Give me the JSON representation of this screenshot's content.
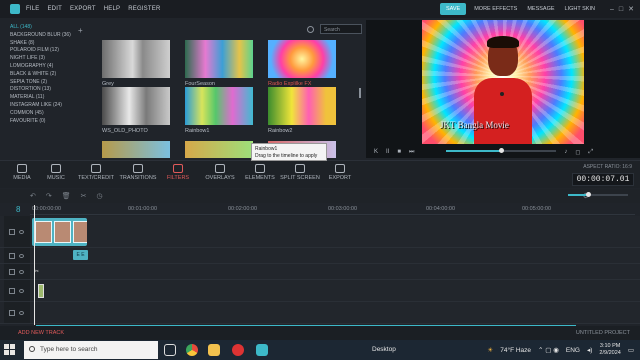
{
  "menu": {
    "items": [
      "FILE",
      "EDIT",
      "EXPORT",
      "HELP",
      "REGISTER"
    ],
    "save": "SAVE",
    "more_effects": "MORE EFFECTS",
    "message": "MESSAGE",
    "skin": "LIGHT SKIN"
  },
  "categories": [
    "ALL (148)",
    "BACKGROUND BLUR (36)",
    "SHAKE (8)",
    "POLAROID FILM (12)",
    "NIGHT LIFE (3)",
    "LOMOGRAPHY (4)",
    "BLACK & WHITE (2)",
    "SEPIA TONE (2)",
    "DISTORTION (13)",
    "MATERIAL (11)",
    "INSTAGRAM LIKE (24)",
    "COMMON (45)",
    "FAVOURITE (0)"
  ],
  "search": {
    "placeholder": "Search"
  },
  "effects": [
    {
      "label": "Grey",
      "highlight": false
    },
    {
      "label": "FourSeason",
      "highlight": false
    },
    {
      "label": "Radio Explilke FX",
      "highlight": true
    },
    {
      "label": "WS_OLD_PHOTO",
      "highlight": false
    },
    {
      "label": "Rainbow1",
      "highlight": false
    },
    {
      "label": "Rainbow2",
      "highlight": false
    }
  ],
  "tooltip": {
    "title": "Rainbow1",
    "hint": "Drag to the timeline to apply"
  },
  "preview": {
    "overlay_text": "JKT Bangla Movie"
  },
  "tools": [
    {
      "label": "MEDIA",
      "active": false
    },
    {
      "label": "MUSIC",
      "active": false
    },
    {
      "label": "TEXT/CREDIT",
      "active": false
    },
    {
      "label": "TRANSITIONS",
      "active": false
    },
    {
      "label": "FILTERS",
      "active": true
    },
    {
      "label": "OVERLAYS",
      "active": false
    },
    {
      "label": "ELEMENTS",
      "active": false
    },
    {
      "label": "SPLIT SCREEN",
      "active": false
    },
    {
      "label": "EXPORT",
      "active": false
    }
  ],
  "aspect_ratio": "ASPECT RATIO: 16:9",
  "timecode": "00:00:07.01",
  "playback_progress": 0.5,
  "ruler": [
    "00:00:00:00",
    "00:01:00:00",
    "00:02:00:00",
    "00:03:00:00",
    "00:04:00:00",
    "00:05:00:00"
  ],
  "playhead_marker": "8",
  "audio_clip_label": "E E",
  "add_track": "ADD NEW TRACK",
  "project": "UNTITLED PROJECT",
  "taskbar": {
    "search_placeholder": "Type here to search",
    "desktop": "Desktop",
    "weather": "74°F  Haze",
    "lang": "ENG",
    "time": "3:10 PM",
    "date": "2/9/2024"
  }
}
